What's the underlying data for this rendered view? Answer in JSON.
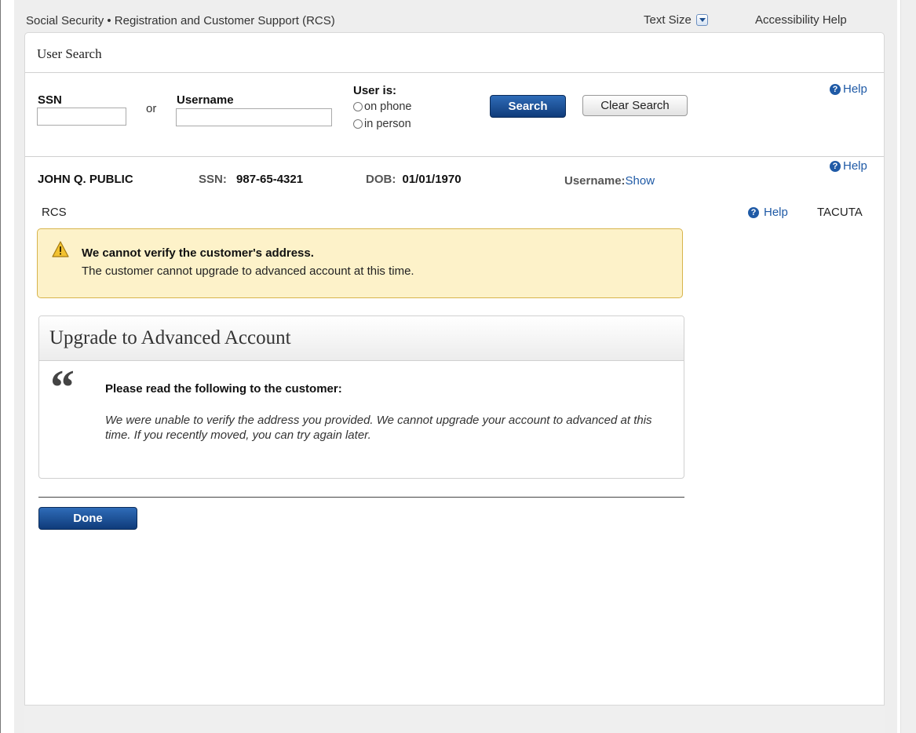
{
  "app": {
    "title": "Social Security • Registration and Customer Support (RCS)",
    "text_size_label": "Text Size",
    "accessibility_help": "Accessibility Help"
  },
  "user_search": {
    "heading": "User Search",
    "ssn_label": "SSN",
    "ssn_value": "",
    "or_text": "or",
    "username_label": "Username",
    "username_value": "",
    "user_is_label": "User is:",
    "options": [
      "on phone",
      "in person"
    ],
    "search_button": "Search",
    "clear_button": "Clear Search",
    "help": "Help"
  },
  "customer": {
    "name": "JOHN Q. PUBLIC",
    "ssn_label": "SSN:",
    "ssn": "987-65-4321",
    "dob_label": "DOB:",
    "dob": "01/01/1970",
    "username_label": "Username:",
    "username_action": "Show",
    "help": "Help"
  },
  "context": {
    "app_label": "RCS",
    "help": "Help",
    "user_id": "TACUTA"
  },
  "alert": {
    "title": "We cannot verify the customer's address.",
    "message": "The customer cannot upgrade to advanced account at this time."
  },
  "card": {
    "title": "Upgrade to Advanced Account",
    "quote_glyph": "“",
    "instruction": "Please read the following to the customer:",
    "script": "We were unable to verify the address you provided. We cannot upgrade your account to advanced at this time. If you recently moved, you can try again later."
  },
  "actions": {
    "done": "Done"
  },
  "colors": {
    "accent": "#1f5aa6",
    "primary_button": "#0f3b7a",
    "alert_bg": "#fdf2c9",
    "alert_border": "#d7b44c"
  }
}
